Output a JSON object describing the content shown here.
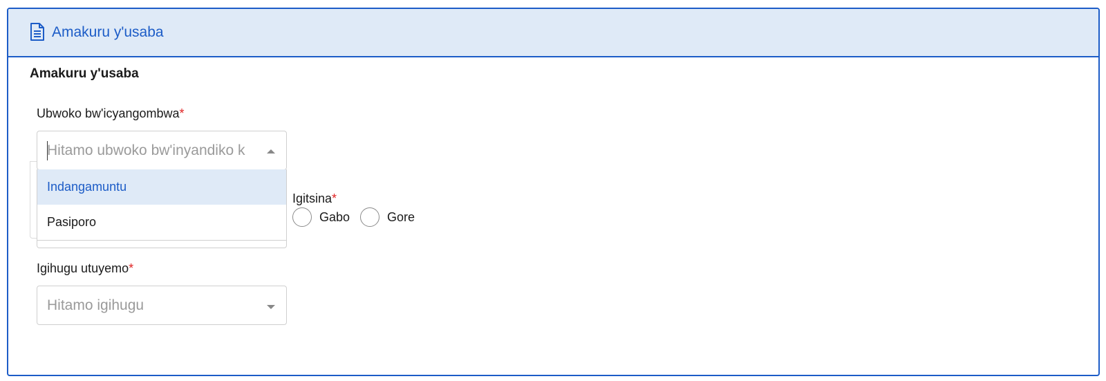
{
  "panel": {
    "title": "Amakuru y'usaba",
    "icon": "document-icon",
    "accent_color": "#1c5cc7",
    "header_bg": "#dfeaf7"
  },
  "form": {
    "section_title": "Amakuru y'usaba",
    "required_marker": "*",
    "document_type": {
      "label": "Ubwoko bw'icyangombwa",
      "placeholder": "Hitamo ubwoko bw'inyandiko k",
      "open": true,
      "options": [
        "Indangamuntu",
        "Pasiporo"
      ],
      "highlighted_index": 0
    },
    "gender": {
      "label": "Igitsina",
      "options": [
        "Gabo",
        "Gore"
      ],
      "selected": null
    },
    "country": {
      "label": "Igihugu utuyemo",
      "placeholder": "Hitamo igihugu"
    }
  }
}
